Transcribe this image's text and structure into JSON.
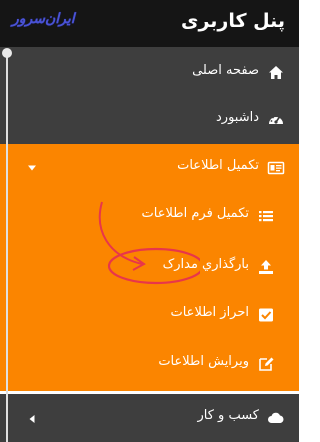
{
  "header": {
    "title": "پنل کاربری",
    "logo_text": "ایران‌سرور"
  },
  "menu": {
    "home": "صفحه اصلی",
    "dashboard": "داشبورد",
    "complete_info": "تکمیل اطلاعات",
    "complete_form": "تکمیل فرم اطلاعات",
    "upload_docs": "بارگذاري مدارک",
    "verify_info": "احراز اطلاعات",
    "edit_info": "ویرایش اطلاعات",
    "business": "کسب و کار"
  },
  "colors": {
    "accent": "#fb8500",
    "sidebar_bg": "#3e3e3e",
    "header_bg": "#151515",
    "annotation": "#e8364a"
  },
  "icons": {
    "home": "home-icon",
    "dashboard": "dashboard-icon",
    "complete_info": "id-card-icon",
    "complete_form": "list-icon",
    "upload_docs": "upload-icon",
    "verify_info": "check-square-icon",
    "edit_info": "edit-icon",
    "business": "cloud-icon"
  }
}
